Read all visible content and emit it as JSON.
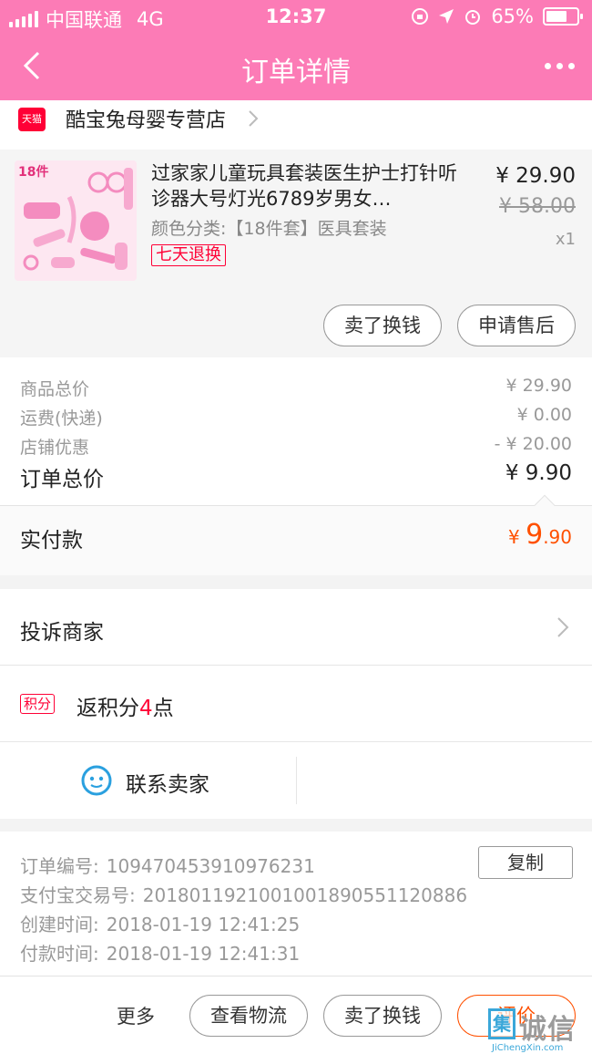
{
  "status_bar": {
    "carrier": "中国联通",
    "network": "4G",
    "time": "12:37",
    "battery_percent": "65%"
  },
  "nav": {
    "title": "订单详情"
  },
  "store": {
    "badge": "天猫",
    "name": "酷宝兔母婴专营店"
  },
  "product": {
    "title": "过家家儿童玩具套装医生护士打针听诊器大号灯光6789岁男女…",
    "sku": "颜色分类:【18件套】医具套装",
    "return_tag": "七天退换",
    "price": "¥ 29.90",
    "original_price": "¥ 58.00",
    "quantity": "x1",
    "thumbnail_text": "18件",
    "actions": {
      "sell": "卖了换钱",
      "after_sale": "申请售后"
    }
  },
  "totals": {
    "rows": [
      {
        "label": "商品总价",
        "value": "¥ 29.90"
      },
      {
        "label": "运费(快递)",
        "value": "¥ 0.00"
      },
      {
        "label": "店铺优惠",
        "value": "- ¥ 20.00"
      }
    ],
    "order_total": {
      "label": "订单总价",
      "value": "¥ 9.90"
    },
    "paid": {
      "label": "实付款",
      "currency": "¥",
      "integer": "9",
      "decimal": ".90"
    }
  },
  "complaint": {
    "label": "投诉商家"
  },
  "points": {
    "badge": "积分",
    "prefix": "返积分",
    "value": "4",
    "suffix": "点"
  },
  "contact": {
    "label": "联系卖家"
  },
  "order_info": {
    "copy_label": "复制",
    "rows": [
      {
        "label": "订单编号:",
        "value": "109470453910976231"
      },
      {
        "label": "支付宝交易号:",
        "value": "2018011921001001890551120886"
      },
      {
        "label": "创建时间:",
        "value": "2018-01-19 12:41:25"
      },
      {
        "label": "付款时间:",
        "value": "2018-01-19 12:41:31"
      }
    ]
  },
  "bottom_bar": {
    "more": "更多",
    "logistics": "查看物流",
    "sell": "卖了换钱",
    "review": "评价"
  },
  "watermark": {
    "icon_char": "集",
    "text": "诚信",
    "sub": "JiChengXin.com"
  },
  "colors": {
    "nav_pink": "#fc7bb6",
    "tmall_red": "#ff0036",
    "price_orange": "#ff5000",
    "contact_blue": "#2aa0df"
  }
}
